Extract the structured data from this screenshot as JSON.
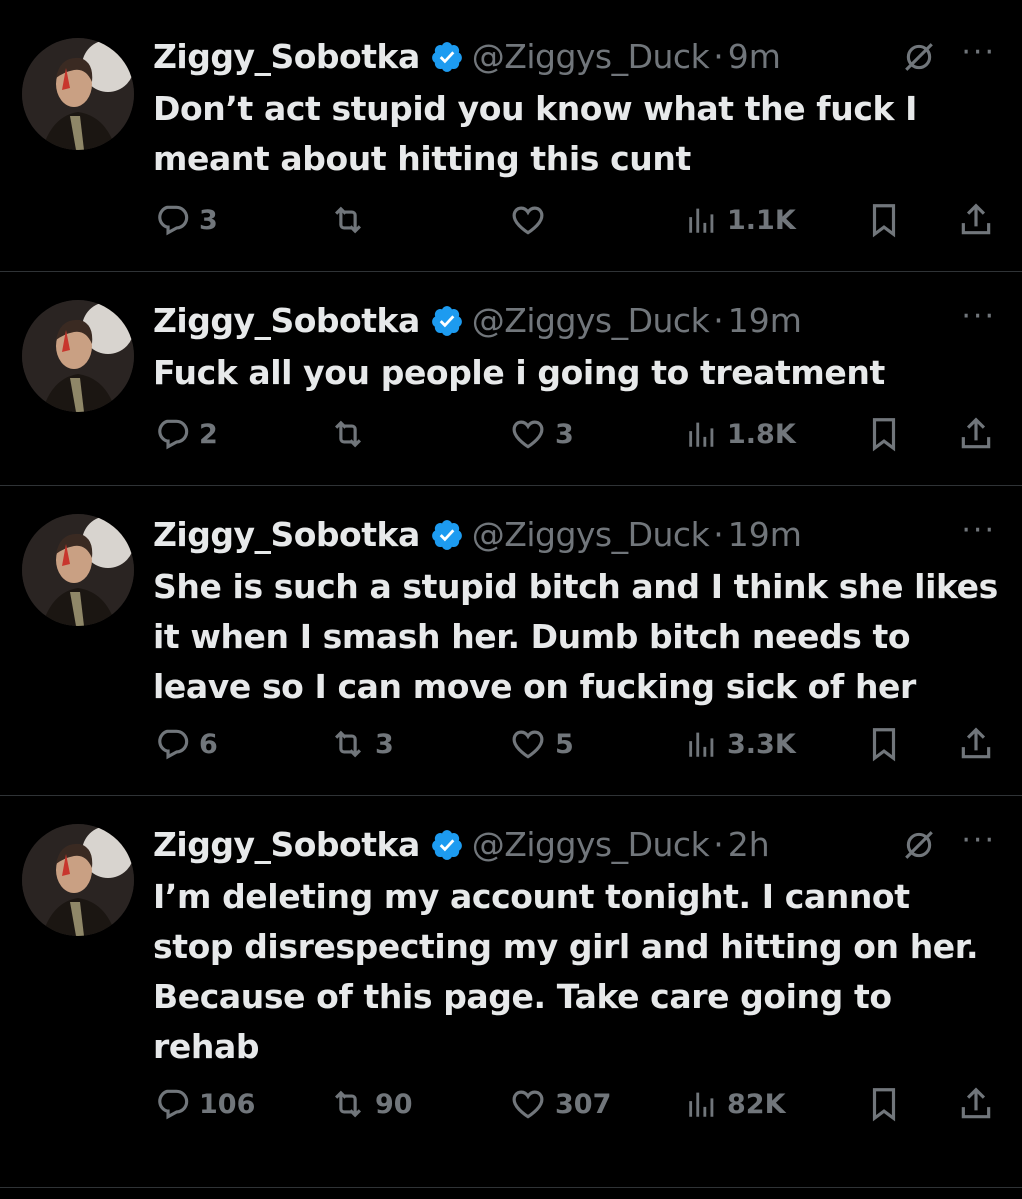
{
  "tweets": [
    {
      "name": "Ziggy_Sobotka",
      "handle": "@Ziggys_Duck",
      "separator": "·",
      "time": "9m",
      "grok_icon": true,
      "text": "Don’t act stupid you know what the fuck I meant about hitting this cunt",
      "replies": "3",
      "retweets": "",
      "likes": "",
      "views": "1.1K"
    },
    {
      "name": "Ziggy_Sobotka",
      "handle": "@Ziggys_Duck",
      "separator": "·",
      "time": "19m",
      "grok_icon": false,
      "text": "Fuck all you people i going to treatment",
      "replies": "2",
      "retweets": "",
      "likes": "3",
      "views": "1.8K"
    },
    {
      "name": "Ziggy_Sobotka",
      "handle": "@Ziggys_Duck",
      "separator": "·",
      "time": "19m",
      "grok_icon": false,
      "text": "She is such a stupid bitch and I think she likes it when I smash her. Dumb bitch needs to leave so I can move on fucking sick of her",
      "replies": "6",
      "retweets": "3",
      "likes": "5",
      "views": "3.3K"
    },
    {
      "name": "Ziggy_Sobotka",
      "handle": "@Ziggys_Duck",
      "separator": "·",
      "time": "2h",
      "grok_icon": true,
      "text": "I’m deleting my account tonight. I cannot stop disrespecting my girl and hitting on her. Because of this page. Take care going to rehab",
      "replies": "106",
      "retweets": "90",
      "likes": "307",
      "views": "82K"
    }
  ],
  "more_label": "···",
  "colors": {
    "background": "#000000",
    "text": "#e7e9ea",
    "secondary": "#71767b",
    "divider": "#2f3336",
    "verified": "#1d9bf0"
  }
}
